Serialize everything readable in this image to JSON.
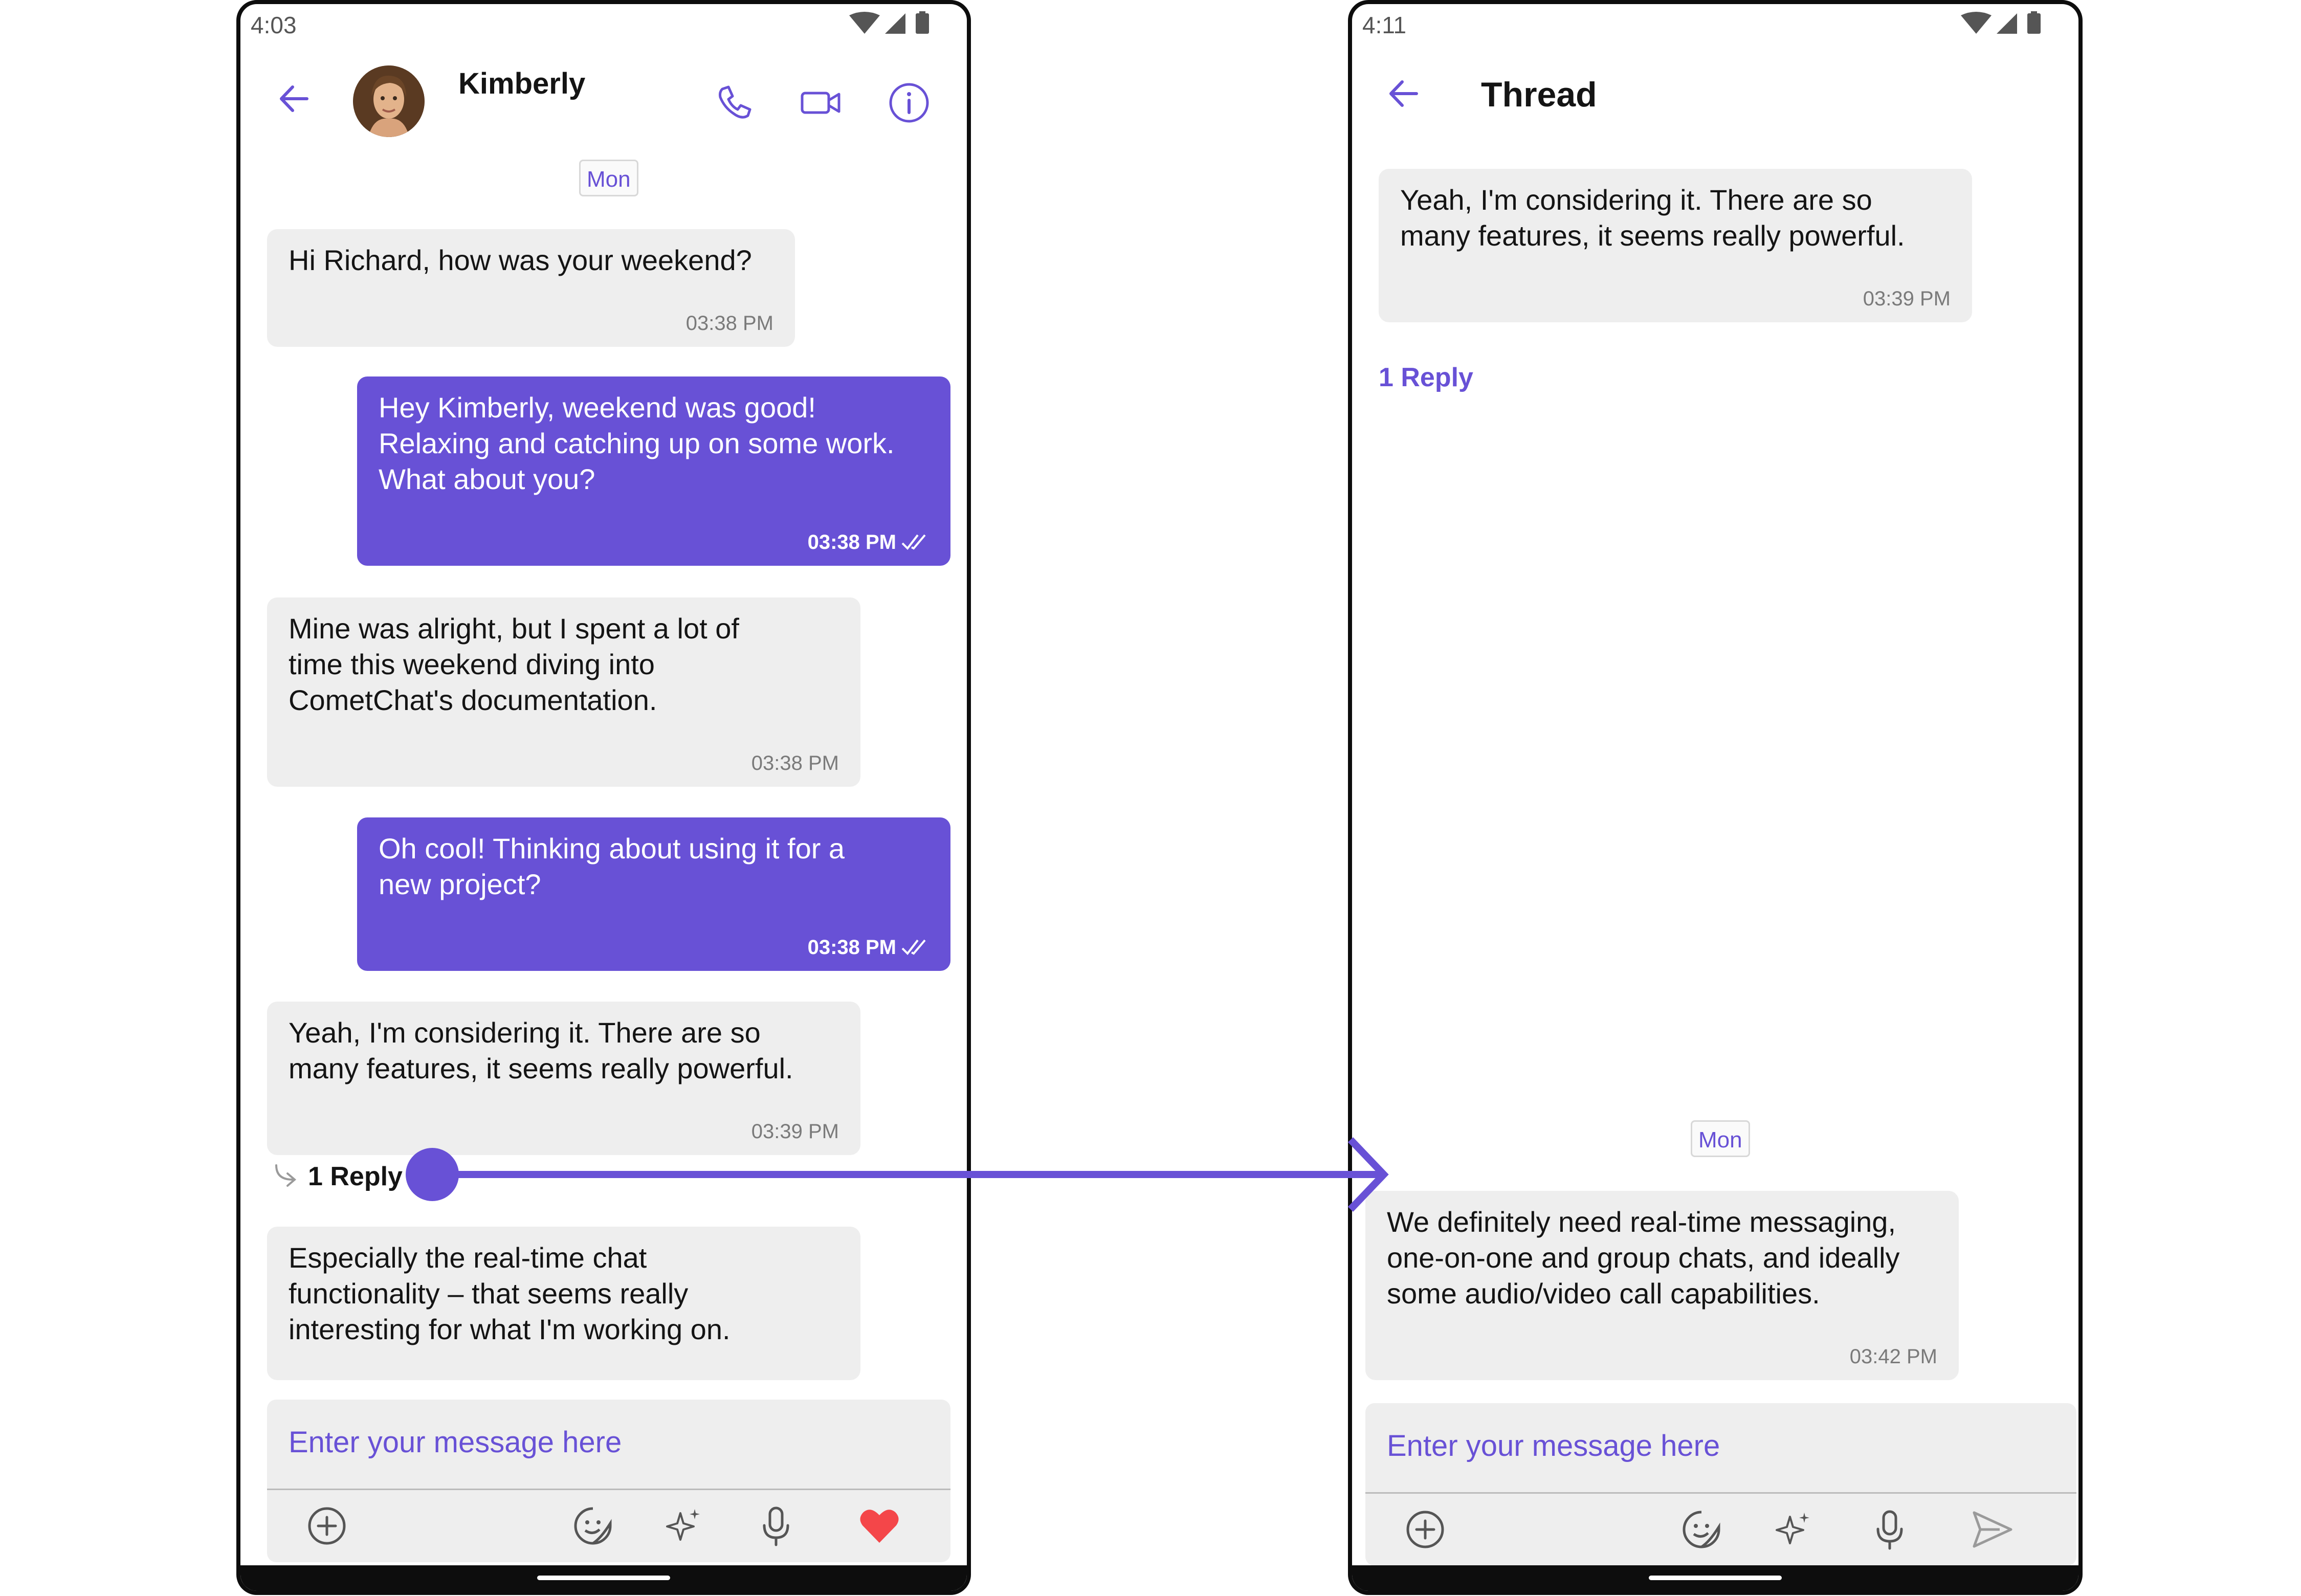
{
  "colors": {
    "accent": "#6851D6",
    "incoming_bubble": "#EEEEEE",
    "heart": "#F44649"
  },
  "left_phone": {
    "status_time": "4:03",
    "header": {
      "title": "Kimberly",
      "icons": [
        "back-arrow-icon",
        "phone-call-icon",
        "video-call-icon",
        "info-icon"
      ]
    },
    "date_chip": "Mon",
    "messages": [
      {
        "text": "Hi Richard, how was your weekend?",
        "time": "03:38 PM",
        "outgoing": false
      },
      {
        "text": "Hey Kimberly, weekend was good!\nRelaxing and catching up on some work.\nWhat about you?",
        "time": "03:38 PM",
        "outgoing": true
      },
      {
        "text": "Mine was alright, but I spent a lot of\ntime this weekend diving into\nCometChat's documentation.",
        "time": "03:38 PM",
        "outgoing": false
      },
      {
        "text": "Oh cool! Thinking about using it for a\nnew project?",
        "time": "03:38 PM",
        "outgoing": true
      },
      {
        "text": "Yeah, I'm considering it.  There are so\nmany features, it seems really powerful.",
        "time": "03:39 PM",
        "outgoing": false
      },
      {
        "text": "Especially the real-time chat\nfunctionality – that seems really\ninteresting for what I'm working on.",
        "time": "",
        "outgoing": false
      }
    ],
    "reply_label": "1 Reply",
    "composer": {
      "placeholder": "Enter your message here",
      "icons": [
        "add-icon",
        "sticker-icon",
        "ai-sparkle-icon",
        "microphone-icon",
        "heart-icon"
      ]
    }
  },
  "right_phone": {
    "status_time": "4:11",
    "header": {
      "title": "Thread",
      "icons": [
        "back-arrow-icon"
      ]
    },
    "parent_message": {
      "text": "Yeah, I'm considering it.  There are so\nmany features, it seems really powerful.",
      "time": "03:39 PM"
    },
    "reply_count": "1 Reply",
    "date_chip": "Mon",
    "reply_message": {
      "text": "We definitely need real-time messaging,\none-on-one and group chats, and ideally\nsome audio/video call capabilities.",
      "time": "03:42 PM"
    },
    "composer": {
      "placeholder": "Enter your message here",
      "icons": [
        "add-icon",
        "sticker-icon",
        "ai-sparkle-icon",
        "microphone-icon",
        "send-icon"
      ]
    }
  }
}
